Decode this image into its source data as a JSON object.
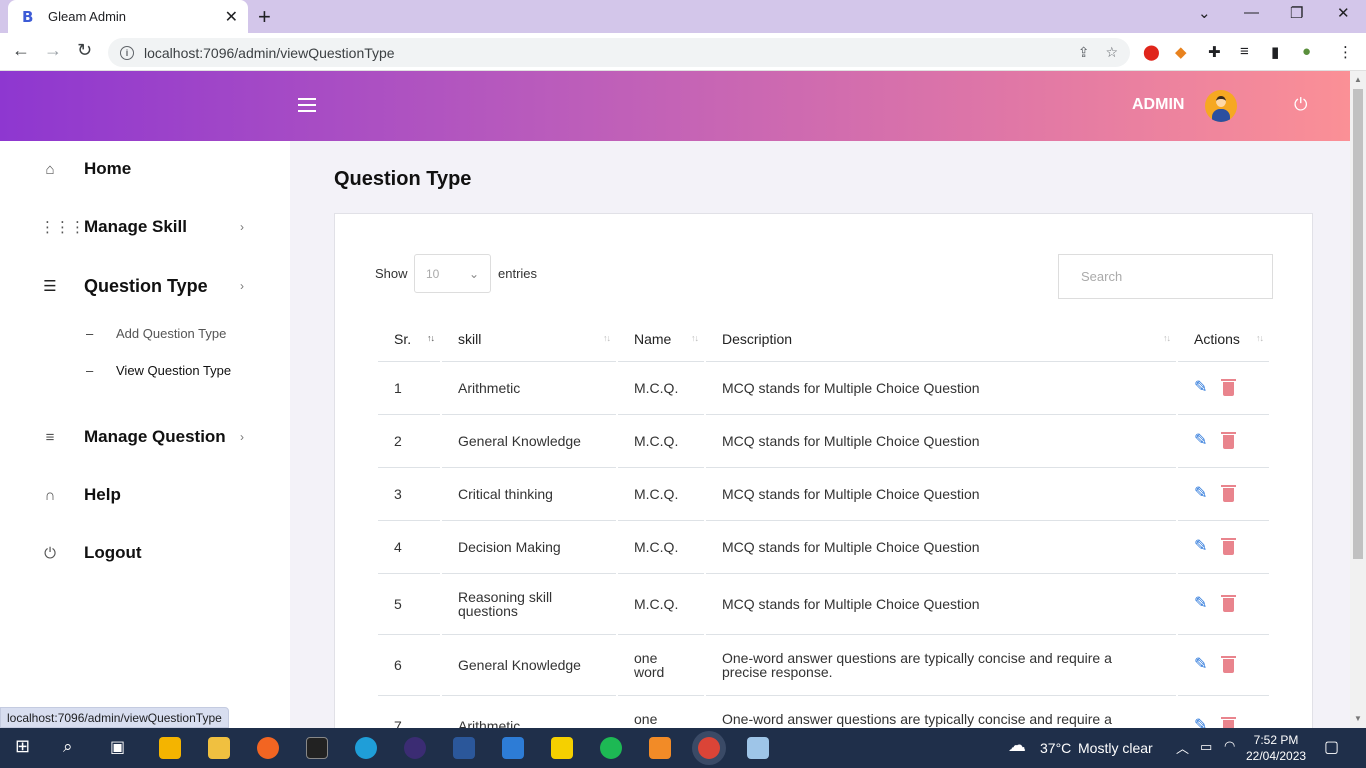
{
  "browser": {
    "tab_title": "Gleam Admin",
    "favicon_letter": "B",
    "url": "localhost:7096/admin/viewQuestionType",
    "status_url": "localhost:7096/admin/viewQuestionType"
  },
  "header": {
    "user_label": "ADMIN"
  },
  "sidebar": {
    "items": [
      {
        "label": "Home"
      },
      {
        "label": "Manage Skill"
      },
      {
        "label": "Question Type"
      },
      {
        "label": "Manage Question"
      },
      {
        "label": "Help"
      },
      {
        "label": "Logout"
      }
    ],
    "sub_items": [
      {
        "label": "Add Question Type"
      },
      {
        "label": "View Question Type"
      }
    ]
  },
  "main": {
    "page_title": "Question Type",
    "show_label": "Show",
    "entries_value": "10",
    "entries_label": "entries",
    "search_placeholder": "Search",
    "table": {
      "headers": [
        "Sr.",
        "skill",
        "Name",
        "Description",
        "Actions"
      ],
      "rows": [
        {
          "sr": "1",
          "skill": "Arithmetic",
          "name": "M.C.Q.",
          "description": "MCQ stands for Multiple Choice Question"
        },
        {
          "sr": "2",
          "skill": "General Knowledge",
          "name": "M.C.Q.",
          "description": "MCQ stands for Multiple Choice Question"
        },
        {
          "sr": "3",
          "skill": "Critical thinking",
          "name": "M.C.Q.",
          "description": "MCQ stands for Multiple Choice Question"
        },
        {
          "sr": "4",
          "skill": "Decision Making",
          "name": "M.C.Q.",
          "description": "MCQ stands for Multiple Choice Question"
        },
        {
          "sr": "5",
          "skill": "Reasoning skill questions",
          "name": "M.C.Q.",
          "description": "MCQ stands for Multiple Choice Question"
        },
        {
          "sr": "6",
          "skill": "General Knowledge",
          "name": "one word",
          "description": "One-word answer questions are typically concise and require a precise response."
        },
        {
          "sr": "7",
          "skill": "Arithmetic",
          "name": "one word",
          "description": "One-word answer questions are typically concise and require a precise response."
        }
      ]
    }
  },
  "taskbar": {
    "weather_temp": "37°C",
    "weather_desc": "Mostly clear",
    "time": "7:52 PM",
    "date": "22/04/2023"
  },
  "colors": {
    "header_gradient_start": "#8e37d0",
    "header_gradient_end": "#fb9096",
    "edit_icon": "#1e6fd9",
    "delete_icon": "#e9848d"
  }
}
